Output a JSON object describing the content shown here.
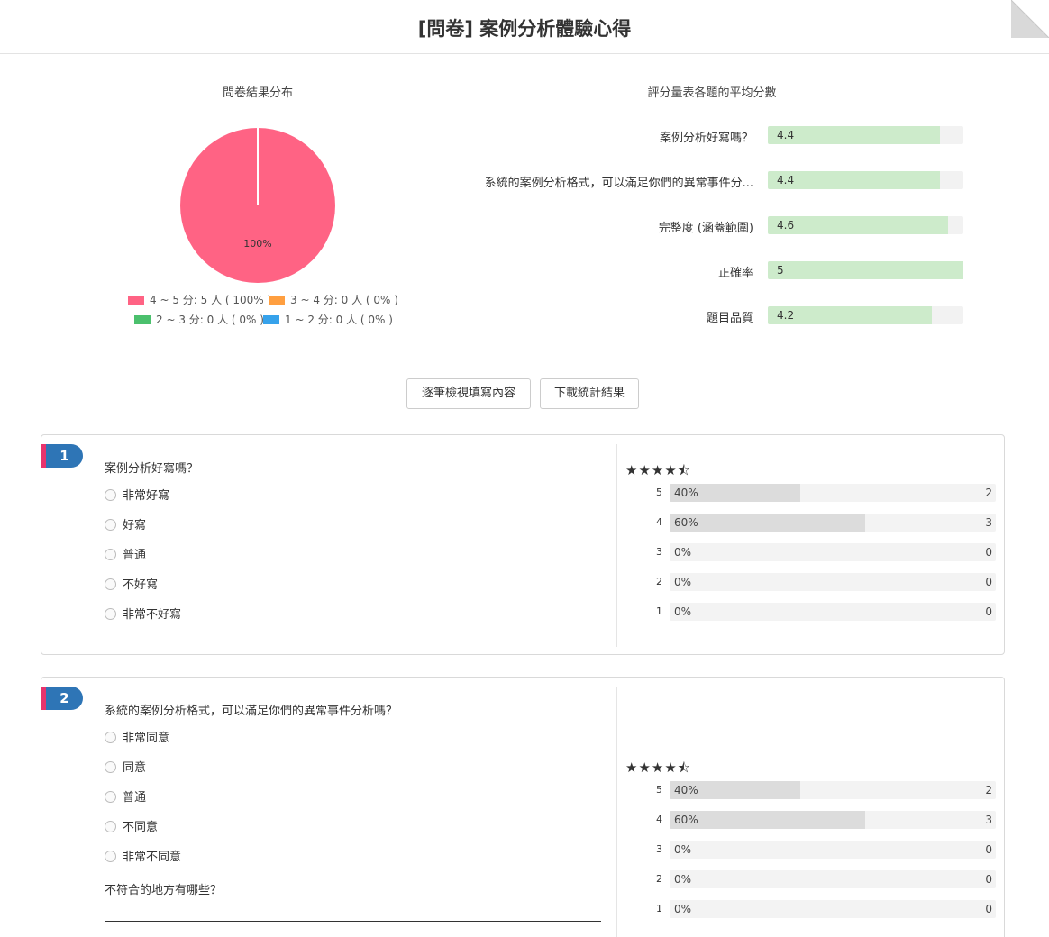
{
  "header": {
    "title": "[問卷] 案例分析體驗心得"
  },
  "pie": {
    "title": "問卷結果分布",
    "slice_label": "100%",
    "legend": [
      {
        "label": "4 ~ 5 分: 5 人 ( 100% )",
        "color": "#ff6384"
      },
      {
        "label": "3 ~ 4 分: 0 人 ( 0% )",
        "color": "#ff9f40"
      },
      {
        "label": "2 ~ 3 分: 0 人 ( 0% )",
        "color": "#4bc06d"
      },
      {
        "label": "1 ~ 2 分: 0 人 ( 0% )",
        "color": "#36a2eb"
      }
    ]
  },
  "chart_data": [
    {
      "type": "pie",
      "title": "問卷結果分布",
      "categories": [
        "4 ~ 5 分",
        "3 ~ 4 分",
        "2 ~ 3 分",
        "1 ~ 2 分"
      ],
      "values": [
        5,
        0,
        0,
        0
      ],
      "percentages": [
        100,
        0,
        0,
        0
      ],
      "colors": [
        "#ff6384",
        "#ff9f40",
        "#4bc06d",
        "#36a2eb"
      ],
      "legend": "bottom"
    },
    {
      "type": "bar",
      "title": "評分量表各題的平均分數",
      "categories": [
        "案例分析好寫嗎？",
        "系統的案例分析格式，可以滿足你們的異常事件分...",
        "完整度 (涵蓋範圍)",
        "正確率",
        "題目品質"
      ],
      "values": [
        4.4,
        4.4,
        4.6,
        5,
        4.2
      ],
      "xlim": [
        0,
        5
      ]
    }
  ],
  "averages": {
    "title": "評分量表各題的平均分數",
    "max": 5,
    "items": [
      {
        "label": "案例分析好寫嗎？",
        "value": "4.4",
        "score": 4.4
      },
      {
        "label": "系統的案例分析格式，可以滿足你們的異常事件分...",
        "value": "4.4",
        "score": 4.4
      },
      {
        "label": "完整度 (涵蓋範圍)",
        "value": "4.6",
        "score": 4.6
      },
      {
        "label": "正確率",
        "value": "5",
        "score": 5
      },
      {
        "label": "題目品質",
        "value": "4.2",
        "score": 4.2
      }
    ]
  },
  "buttons": {
    "view_each": "逐筆檢視填寫內容",
    "download": "下載統計結果"
  },
  "questions": [
    {
      "number": "1",
      "text": "案例分析好寫嗎？",
      "options": [
        "非常好寫",
        "好寫",
        "普通",
        "不好寫",
        "非常不好寫"
      ],
      "stars": "★★★★⯪",
      "rows": [
        {
          "n": "5",
          "pct": "40%",
          "frac": 0.4,
          "count": "2"
        },
        {
          "n": "4",
          "pct": "60%",
          "frac": 0.6,
          "count": "3"
        },
        {
          "n": "3",
          "pct": "0%",
          "frac": 0,
          "count": "0"
        },
        {
          "n": "2",
          "pct": "0%",
          "frac": 0,
          "count": "0"
        },
        {
          "n": "1",
          "pct": "0%",
          "frac": 0,
          "count": "0"
        }
      ]
    },
    {
      "number": "2",
      "text": "系統的案例分析格式，可以滿足你們的異常事件分析嗎？",
      "options": [
        "非常同意",
        "同意",
        "普通",
        "不同意",
        "非常不同意"
      ],
      "followup": "不符合的地方有哪些？",
      "stars": "★★★★⯪",
      "rows": [
        {
          "n": "5",
          "pct": "40%",
          "frac": 0.4,
          "count": "2"
        },
        {
          "n": "4",
          "pct": "60%",
          "frac": 0.6,
          "count": "3"
        },
        {
          "n": "3",
          "pct": "0%",
          "frac": 0,
          "count": "0"
        },
        {
          "n": "2",
          "pct": "0%",
          "frac": 0,
          "count": "0"
        },
        {
          "n": "1",
          "pct": "0%",
          "frac": 0,
          "count": "0"
        }
      ]
    }
  ]
}
